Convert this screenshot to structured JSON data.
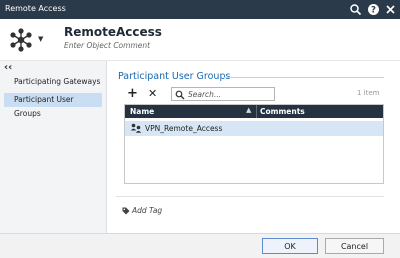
{
  "window": {
    "title": "Remote Access"
  },
  "icons": {
    "search": "search-icon",
    "help": "help-icon",
    "close": "close-icon",
    "object": "network-object-icon",
    "caret": "chevron-down-icon",
    "collapse": "collapse-icon",
    "add": "plus-icon",
    "remove": "x-icon",
    "group": "user-group-icon",
    "tag": "tag-icon"
  },
  "header": {
    "name": "RemoteAccess",
    "comment_placeholder": "Enter Object Comment"
  },
  "nav": {
    "collapse_glyph": "‹‹",
    "items": [
      {
        "label": "Participating Gateways",
        "selected": false
      },
      {
        "label": "Participant User Groups",
        "selected": true
      }
    ]
  },
  "main": {
    "section_title": "Participant User Groups",
    "toolbar": {
      "add_glyph": "+",
      "remove_glyph": "✕"
    },
    "search_placeholder": "Search...",
    "item_count": "1 item",
    "columns": {
      "name": "Name",
      "comments": "Comments"
    },
    "rows": [
      {
        "name": "VPN_Remote_Access",
        "comments": ""
      }
    ],
    "add_tag": "Add Tag"
  },
  "footer": {
    "ok": "OK",
    "cancel": "Cancel"
  },
  "colors": {
    "titlebar": "#2b3a4a",
    "grid_header": "#243242",
    "accent": "#1a68b1",
    "selection": "#c9def3",
    "row_selection": "#d6e6f5"
  }
}
